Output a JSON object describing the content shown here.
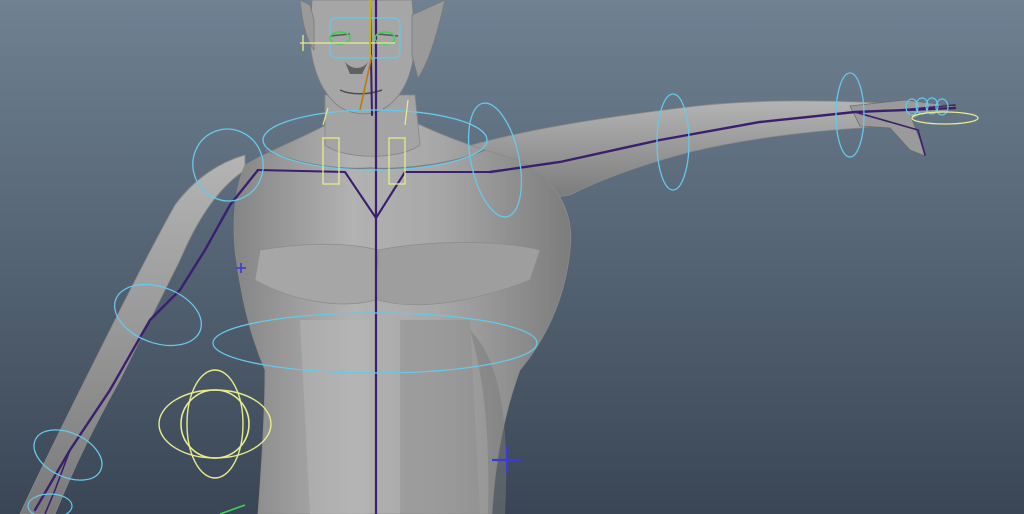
{
  "viewport": {
    "background_top": "#6f8192",
    "background_bottom": "#3a4655"
  },
  "mesh": {
    "base": "#9c9c9c",
    "light": "#b3b3b3",
    "dark": "#6e6e6e",
    "edge": "#7e7e7e"
  },
  "rig": {
    "bone_color": "#3a1f6e",
    "fk_control_color": "#66c8ea",
    "ik_control_color": "#e8ec8c",
    "eye_control_color": "#3fd05a",
    "locator_color": "#3b3bd8",
    "head_joint_color": "#c8b400"
  }
}
